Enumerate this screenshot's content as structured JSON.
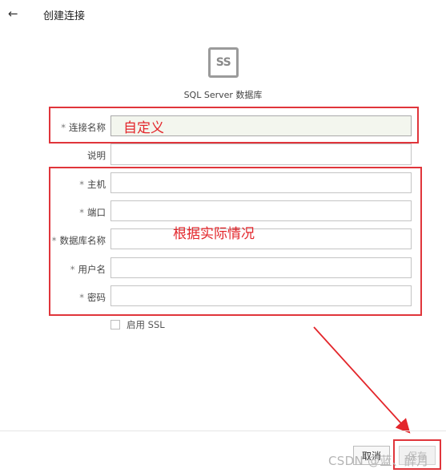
{
  "header": {
    "back_icon": "←",
    "title": "创建连接"
  },
  "logo": {
    "text": "SS"
  },
  "db_type_label": "SQL Server 数据库",
  "form": {
    "required_mark": "*",
    "connection_name": {
      "label": "连接名称",
      "value": ""
    },
    "description": {
      "label": "说明",
      "value": ""
    },
    "host": {
      "label": "主机",
      "value": ""
    },
    "port": {
      "label": "端口",
      "value": ""
    },
    "database": {
      "label": "数据库名称",
      "value": ""
    },
    "username": {
      "label": "用户名",
      "value": ""
    },
    "password": {
      "label": "密码",
      "value": ""
    },
    "ssl": {
      "label": "启用 SSL",
      "checked": false
    }
  },
  "annotations": {
    "custom_note": "自定义",
    "actual_note": "根据实际情况",
    "color": "#e3262b"
  },
  "footer": {
    "cancel_label": "取消",
    "save_label": "保存"
  },
  "watermark": "CSDN @蓝、醉月"
}
